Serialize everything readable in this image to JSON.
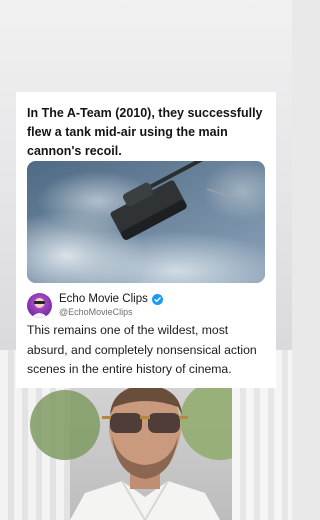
{
  "post": {
    "headline": "In The A-Team (2010), they successfully flew a tank mid-air using the main cannon's recoil.",
    "author_name": "Echo Movie Clips",
    "author_handle": "@EchoMovieClips",
    "verified_icon": "verified-badge-icon",
    "body": "This remains one of the wildest, most absurd, and completely nonsensical action scenes in the entire history of cinema."
  },
  "colors": {
    "verified": "#1d9bf0",
    "avatar": "#9b3fc7",
    "card_bg": "#ffffff"
  }
}
